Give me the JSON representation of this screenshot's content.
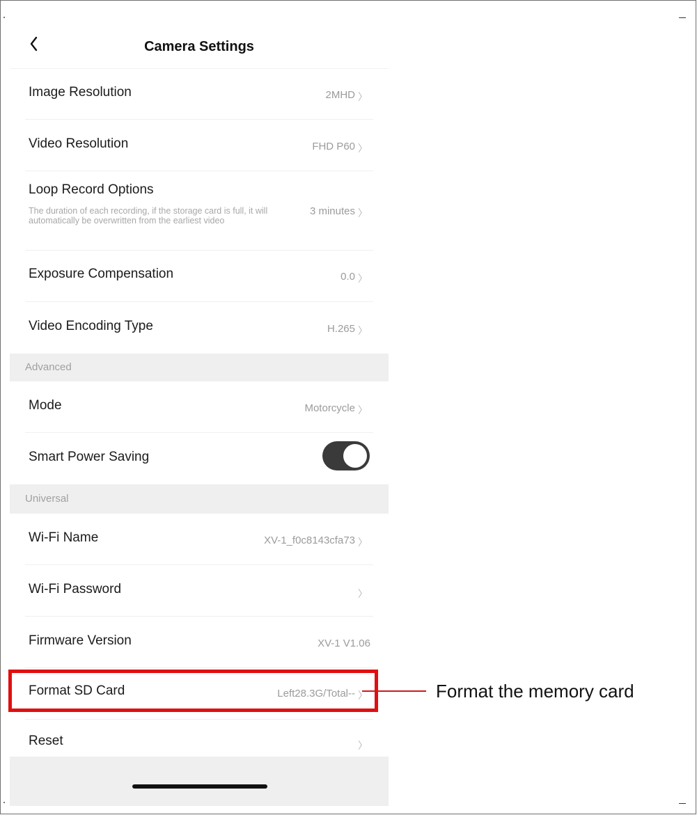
{
  "header": {
    "title": "Camera Settings",
    "back_icon": "chevron-left-icon"
  },
  "rows_main": [
    {
      "label": "Image Resolution",
      "value": "2MHD"
    },
    {
      "label": "Video Resolution",
      "value": "FHD P60"
    },
    {
      "label": "Loop Record Options",
      "value": "3 minutes",
      "description": "The duration of each recording, if the storage card is full, it will automatically be overwritten from the earliest video"
    },
    {
      "label": "Exposure Compensation",
      "value": "0.0"
    },
    {
      "label": "Video Encoding Type",
      "value": "H.265"
    }
  ],
  "advanced": {
    "header": "Advanced",
    "mode": {
      "label": "Mode",
      "value": "Motorcycle"
    },
    "power_saving": {
      "label": "Smart Power Saving",
      "enabled": true
    }
  },
  "universal": {
    "header": "Universal",
    "wifi_name": {
      "label": "Wi-Fi Name",
      "value": "XV-1_f0c8143cfa73"
    },
    "wifi_password": {
      "label": "Wi-Fi Password",
      "value": ""
    },
    "firmware": {
      "label": "Firmware Version",
      "value": "XV-1 V1.06"
    },
    "format_sd": {
      "label": "Format SD Card",
      "value": "Left28.3G/Total--"
    },
    "reset": {
      "label": "Reset"
    }
  },
  "annotation": {
    "callout": "Format the memory card",
    "color": "#e01010"
  },
  "chevron_glyph": "〉"
}
